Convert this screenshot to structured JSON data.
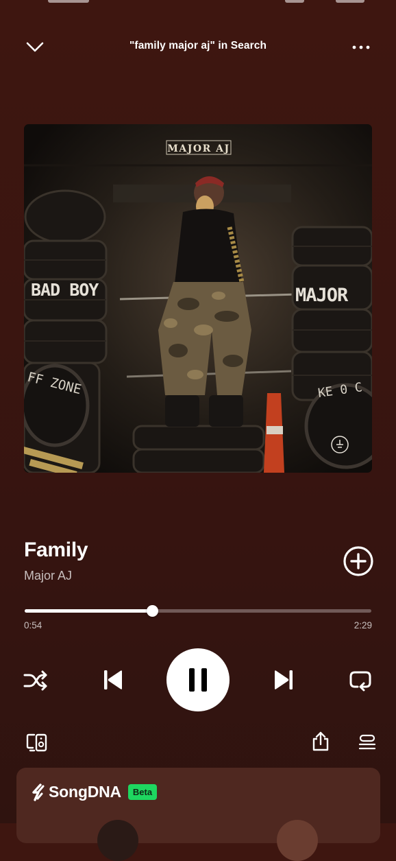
{
  "header": {
    "title": "\"family major aj\" in Search",
    "collapse_icon": "chevron-down-icon",
    "more_icon": "more-dots-icon"
  },
  "album_art": {
    "top_text": "MAJOR AJ",
    "left_tire_text": "BAD BOY",
    "right_tire_text": "MAJOR",
    "lower_left_text": "FF ZONE",
    "lower_right_text": "KE 0 C"
  },
  "track": {
    "title": "Family",
    "artist": "Major AJ",
    "add_icon": "add-circle-icon"
  },
  "progress": {
    "elapsed": "0:54",
    "total": "2:29",
    "fraction": 0.368
  },
  "controls": {
    "shuffle_icon": "shuffle-icon",
    "previous_icon": "skip-previous-icon",
    "play_state": "playing",
    "pause_icon": "pause-icon",
    "next_icon": "skip-next-icon",
    "repeat_icon": "repeat-icon"
  },
  "actions": {
    "devices_icon": "connect-device-icon",
    "share_icon": "share-icon",
    "queue_icon": "queue-icon"
  },
  "songdna": {
    "label": "SongDNA",
    "badge": "Beta",
    "badge_color": "#1ed760"
  },
  "colors": {
    "background": "#3a1510",
    "card": "#4f2820",
    "accent": "#1ed760"
  }
}
